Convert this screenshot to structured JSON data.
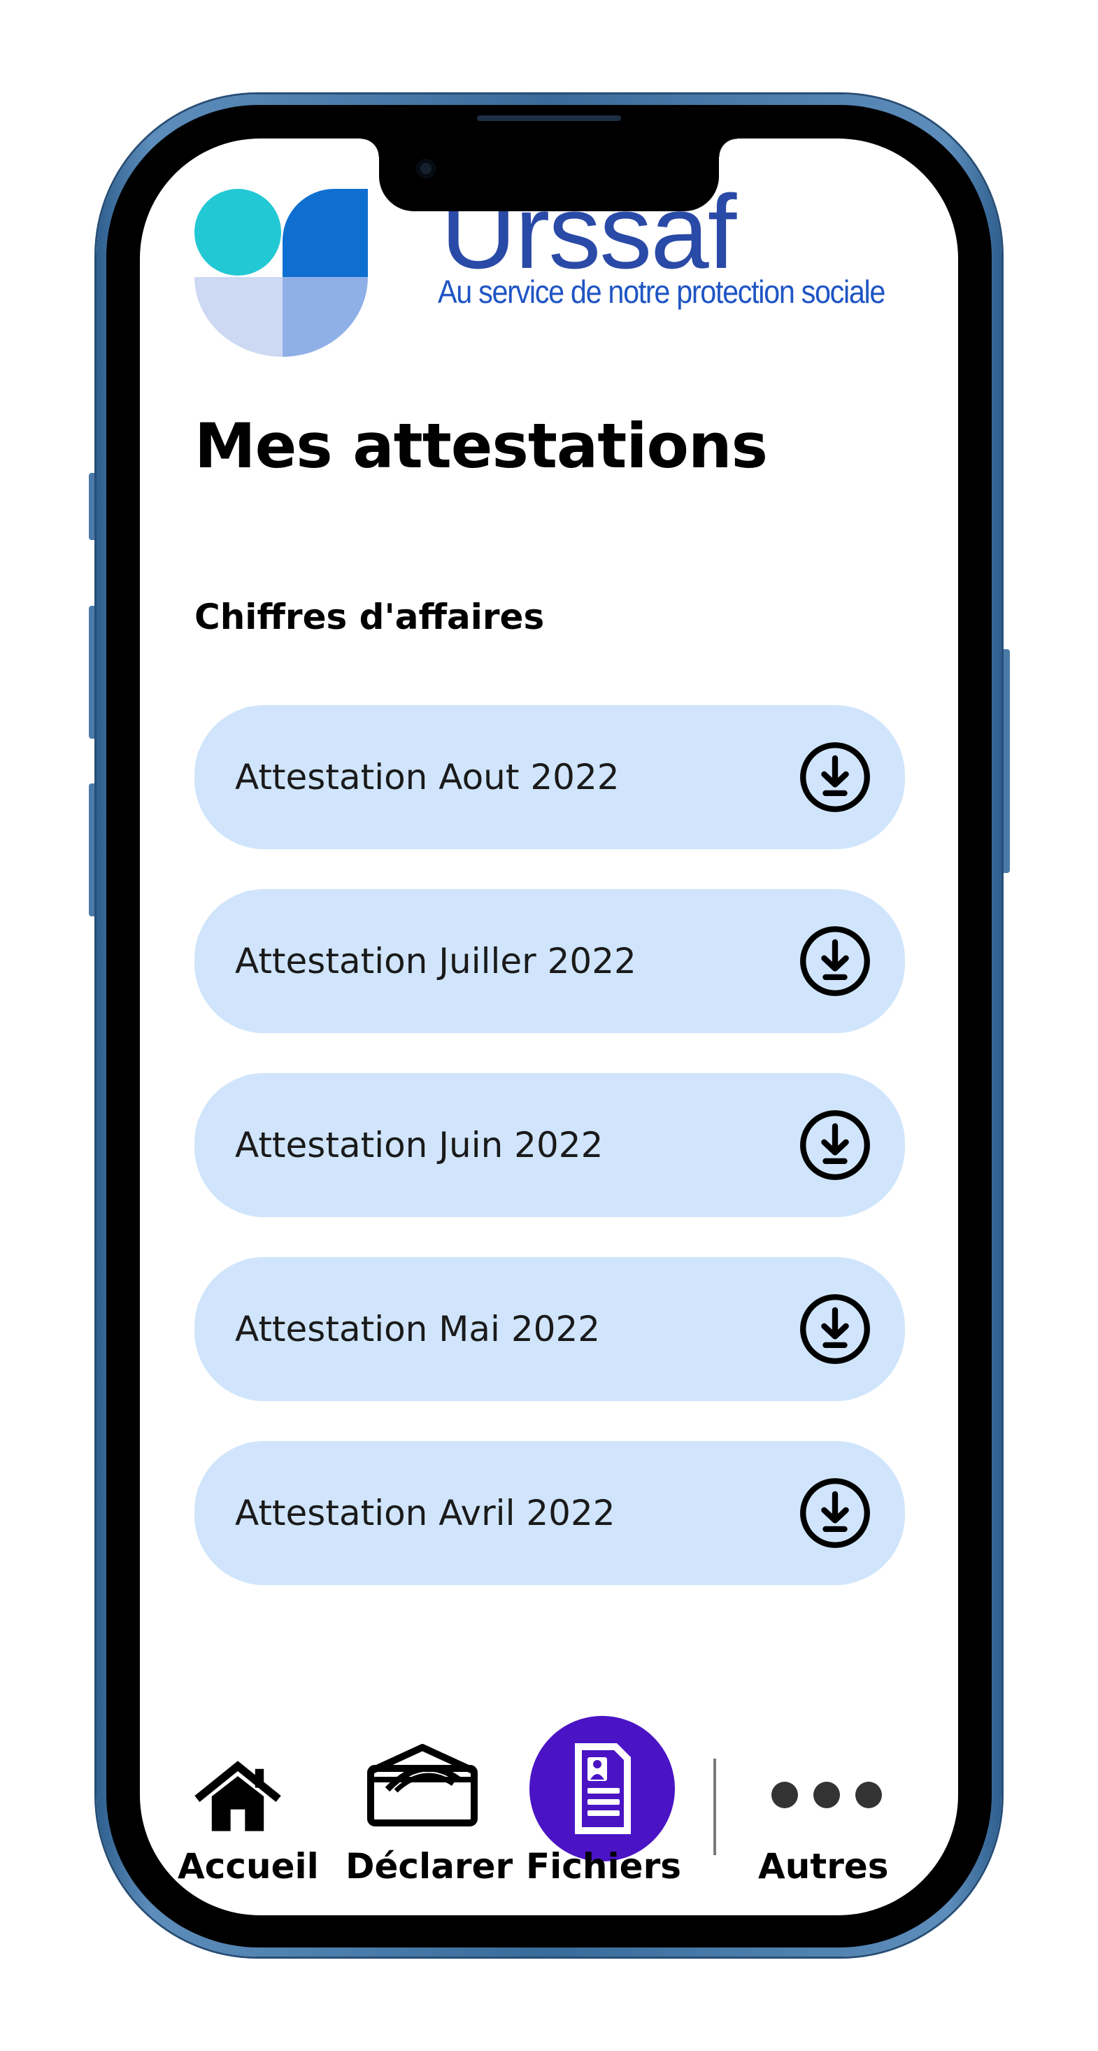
{
  "brand": {
    "name": "Urssaf",
    "tagline": "Au service de notre protection sociale",
    "colors": {
      "wordmark": "#2a4aa7",
      "tagline": "#1f55c4",
      "teal": "#22c8d3",
      "blue": "#0f6fd1",
      "light_blue": "#8fb0e6",
      "pale_blue": "#cdd9f3"
    }
  },
  "page": {
    "title": "Mes attestations",
    "section_title": "Chiffres d'affaires"
  },
  "attestations": [
    {
      "label": "Attestation Aout 2022",
      "icon": "download-circle-icon"
    },
    {
      "label": "Attestation Juiller 2022",
      "icon": "download-circle-icon"
    },
    {
      "label": "Attestation Juin 2022",
      "icon": "download-circle-icon"
    },
    {
      "label": "Attestation Mai 2022",
      "icon": "download-circle-icon"
    },
    {
      "label": "Attestation Avril 2022",
      "icon": "download-circle-icon"
    }
  ],
  "tab_bar": {
    "items": [
      {
        "label": "Accueil",
        "icon": "home-icon",
        "active": false
      },
      {
        "label": "Déclarer",
        "icon": "declare-envelope-icon",
        "active": false
      },
      {
        "label": "Fichiers",
        "icon": "document-file-icon",
        "active": true
      },
      {
        "label": "Autres",
        "icon": "more-dots-icon",
        "active": false
      }
    ],
    "active_color": "#4a14c4"
  },
  "colors": {
    "card_background": "#d0e5fc",
    "phone_frame": "#3a6a99"
  }
}
